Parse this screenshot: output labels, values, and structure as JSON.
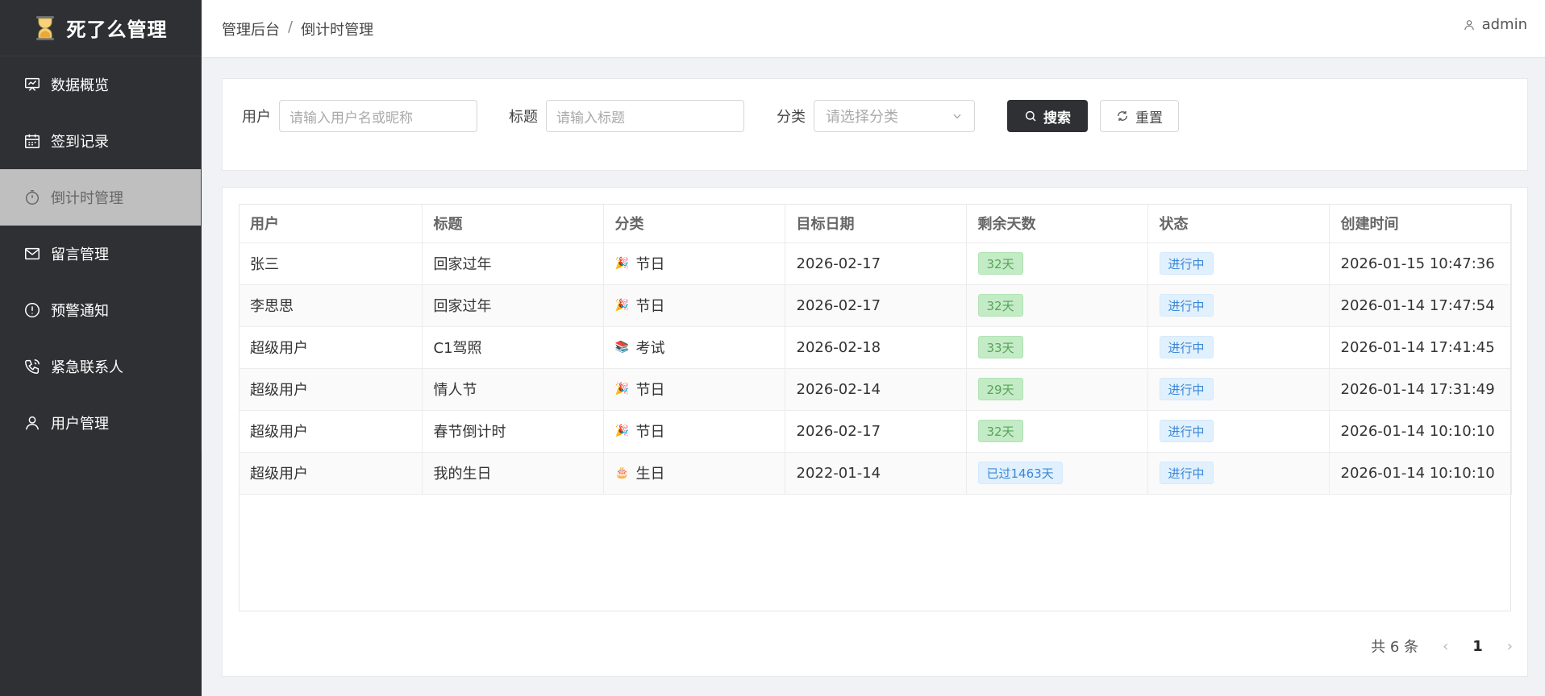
{
  "app": {
    "title": "死了么管理",
    "brand_color": "#2f3033"
  },
  "sidebar": {
    "items": [
      {
        "label": "数据概览",
        "icon": "presentation-icon"
      },
      {
        "label": "签到记录",
        "icon": "calendar-icon"
      },
      {
        "label": "倒计时管理",
        "icon": "timer-icon",
        "active": true
      },
      {
        "label": "留言管理",
        "icon": "mail-icon"
      },
      {
        "label": "预警通知",
        "icon": "warning-icon"
      },
      {
        "label": "紧急联系人",
        "icon": "phone-icon"
      },
      {
        "label": "用户管理",
        "icon": "user-icon"
      }
    ]
  },
  "header": {
    "breadcrumb": [
      "管理后台",
      "倒计时管理"
    ],
    "breadcrumb_sep": "/",
    "user": "admin"
  },
  "search": {
    "user_label": "用户",
    "user_placeholder": "请输入用户名或昵称",
    "title_label": "标题",
    "title_placeholder": "请输入标题",
    "category_label": "分类",
    "category_placeholder": "请选择分类",
    "search_button": "搜索",
    "reset_button": "重置"
  },
  "table": {
    "columns": [
      "用户",
      "标题",
      "分类",
      "目标日期",
      "剩余天数",
      "状态",
      "创建时间"
    ],
    "rows": [
      {
        "user": "张三",
        "title": "回家过年",
        "category_emoji": "🎉",
        "category": "节日",
        "target_date": "2026-02-17",
        "remaining": "32天",
        "remaining_type": "green",
        "status": "进行中",
        "created": "2026-01-15 10:47:36"
      },
      {
        "user": "李思思",
        "title": "回家过年",
        "category_emoji": "🎉",
        "category": "节日",
        "target_date": "2026-02-17",
        "remaining": "32天",
        "remaining_type": "green",
        "status": "进行中",
        "created": "2026-01-14 17:47:54"
      },
      {
        "user": "超级用户",
        "title": "C1驾照",
        "category_emoji": "📚",
        "category": "考试",
        "target_date": "2026-02-18",
        "remaining": "33天",
        "remaining_type": "green",
        "status": "进行中",
        "created": "2026-01-14 17:41:45"
      },
      {
        "user": "超级用户",
        "title": "情人节",
        "category_emoji": "🎉",
        "category": "节日",
        "target_date": "2026-02-14",
        "remaining": "29天",
        "remaining_type": "green",
        "status": "进行中",
        "created": "2026-01-14 17:31:49"
      },
      {
        "user": "超级用户",
        "title": "春节倒计时",
        "category_emoji": "🎉",
        "category": "节日",
        "target_date": "2026-02-17",
        "remaining": "32天",
        "remaining_type": "green",
        "status": "进行中",
        "created": "2026-01-14 10:10:10"
      },
      {
        "user": "超级用户",
        "title": "我的生日",
        "category_emoji": "🎂",
        "category": "生日",
        "target_date": "2022-01-14",
        "remaining": "已过1463天",
        "remaining_type": "blue",
        "status": "进行中",
        "created": "2026-01-14 10:10:10"
      }
    ]
  },
  "pagination": {
    "total": "共 6 条",
    "prev": "‹",
    "current": "1",
    "next": "›"
  }
}
